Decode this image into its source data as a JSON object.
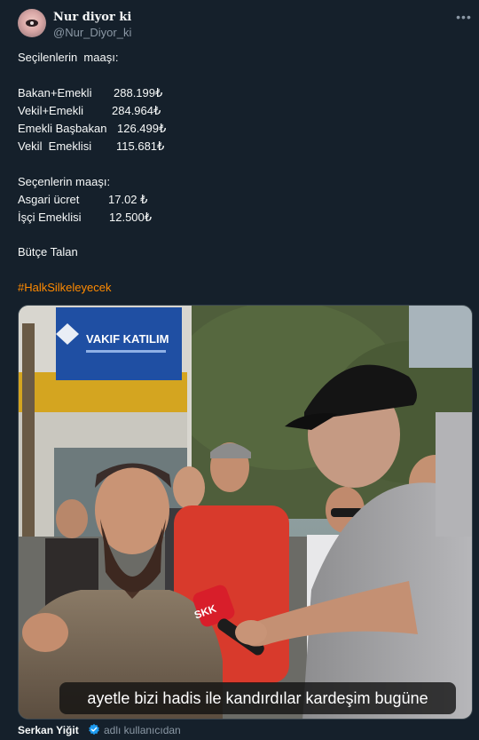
{
  "author": {
    "display_name": "Nur diyor ki",
    "handle": "@Nur_Diyor_ki"
  },
  "more_icon": "more-horizontal-icon",
  "tweet": {
    "line1": "Seçilenlerin  maaşı:",
    "salaries_elected": [
      {
        "label": "Bakan+Emekli",
        "value": "288.199₺"
      },
      {
        "label": "Vekil+Emekli",
        "value": "284.964₺"
      },
      {
        "label": "Emekli Başbakan",
        "value": "126.499₺"
      },
      {
        "label": "Vekil  Emeklisi",
        "value": "115.681₺"
      }
    ],
    "line2": "Seçenlerin maaşı:",
    "salaries_voters": [
      {
        "label": "Asgari ücret",
        "value": "17.02 ₺"
      },
      {
        "label": "İşçi Emeklisi",
        "value": "12.500₺"
      }
    ],
    "line3": "Bütçe Talan",
    "hashtag": "#HalkSilkeleyecek"
  },
  "media": {
    "sign_text": "VAKIF KATILIM",
    "mic_label": "SKK",
    "subtitle": "ayetle bizi hadis ile kandırdılar kardeşim bugüne"
  },
  "footer": {
    "name": "Serkan Yiğit",
    "badge_icon": "verified-badge-icon",
    "suffix": "adlı kullanıcıdan"
  },
  "colors": {
    "background": "#15202b",
    "hashtag": "#ff8a00",
    "secondary_text": "#8b98a5",
    "verified": "#1d9bf0"
  }
}
